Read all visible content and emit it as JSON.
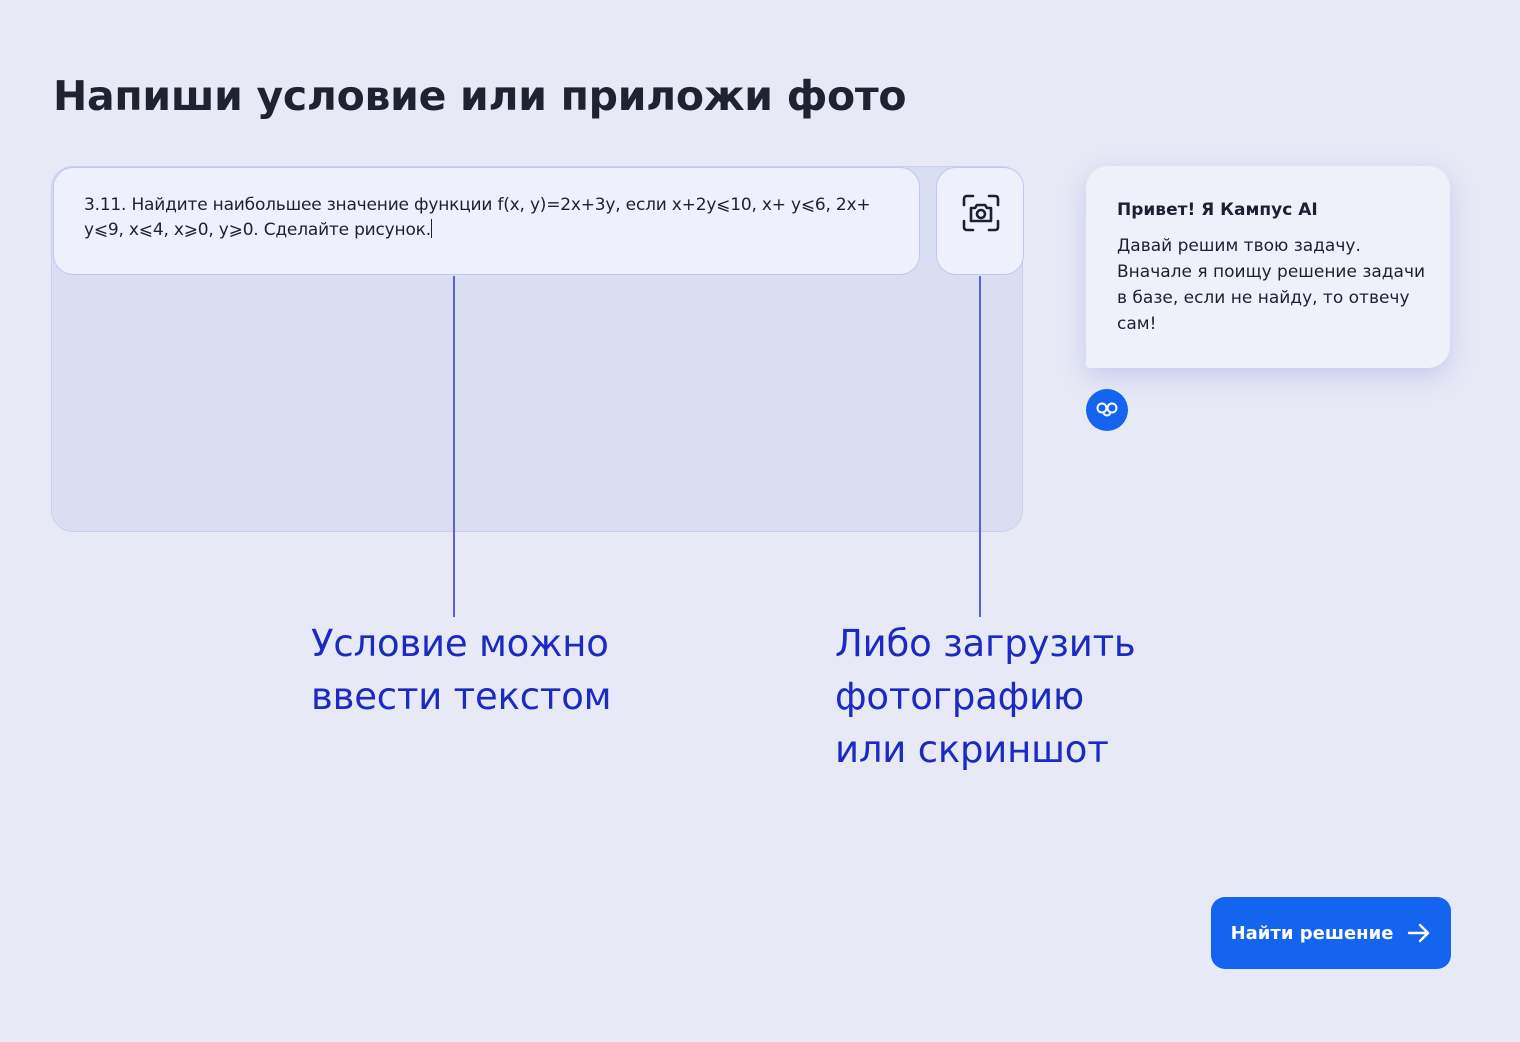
{
  "page": {
    "title": "Напиши условие или приложи фото"
  },
  "task_input": {
    "value": "3.11. Найдите наибольшее значение функции f(x, y)=2x+3y, если x+2y⩽10, x+ y⩽6, 2x+ y⩽9, x⩽4, x⩾0, y⩾0. Сделайте рисунок."
  },
  "upload": {
    "icon": "camera-scan-icon"
  },
  "callouts": {
    "text_hint": [
      "Условие можно",
      "ввести текстом"
    ],
    "photo_hint": [
      "Либо загрузить",
      "фотографию",
      "или скриншот"
    ]
  },
  "assistant": {
    "name": "Привет! Я Кампус AI",
    "message": "Давай решим твою задачу. Вначале я поищу решение задачи в базе, если не найду, то отвечу сам!",
    "avatar_icon": "kampus-ai-logo-icon"
  },
  "submit": {
    "label": "Найти решение",
    "icon": "arrow-right-icon"
  },
  "colors": {
    "background": "#e8e9f6",
    "accent": "#1464f0",
    "callout_text": "#1b2bc1",
    "annotation_line": "#5a63d6"
  }
}
